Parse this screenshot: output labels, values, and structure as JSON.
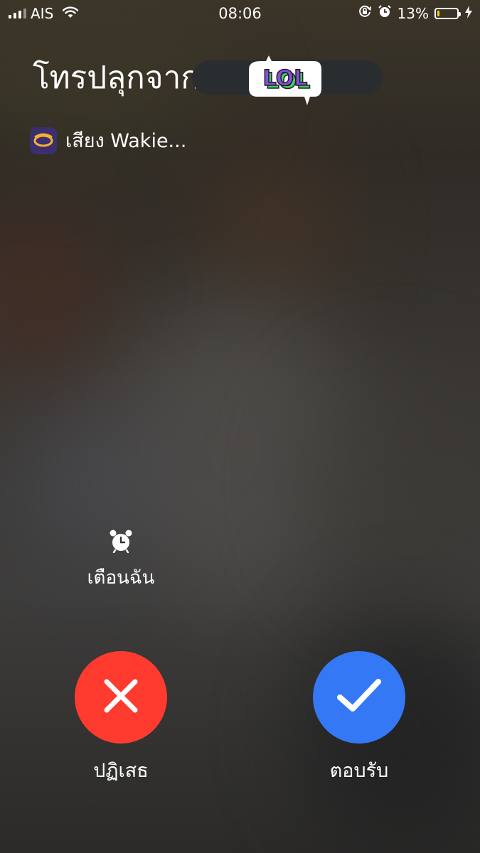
{
  "status_bar": {
    "carrier": "AIS",
    "time": "08:06",
    "battery_percent": "13%",
    "battery_level": 0.13,
    "icons": [
      "signal-icon",
      "wifi-icon",
      "orientation-lock-icon",
      "alarm-icon",
      "battery-icon",
      "charging-icon"
    ]
  },
  "call": {
    "title": "โทรปลุกจาก",
    "sticker_text": "LOL",
    "app_label": "เสียง Wakie..."
  },
  "actions": {
    "remind_label": "เตือนฉัน",
    "decline_label": "ปฏิเสธ",
    "accept_label": "ตอบรับ"
  },
  "colors": {
    "decline": "#ff3b30",
    "accept": "#3478f6",
    "battery_fill": "#ffcc00",
    "sticker_purple": "#8a4de0",
    "sticker_green": "#3fd06a"
  }
}
